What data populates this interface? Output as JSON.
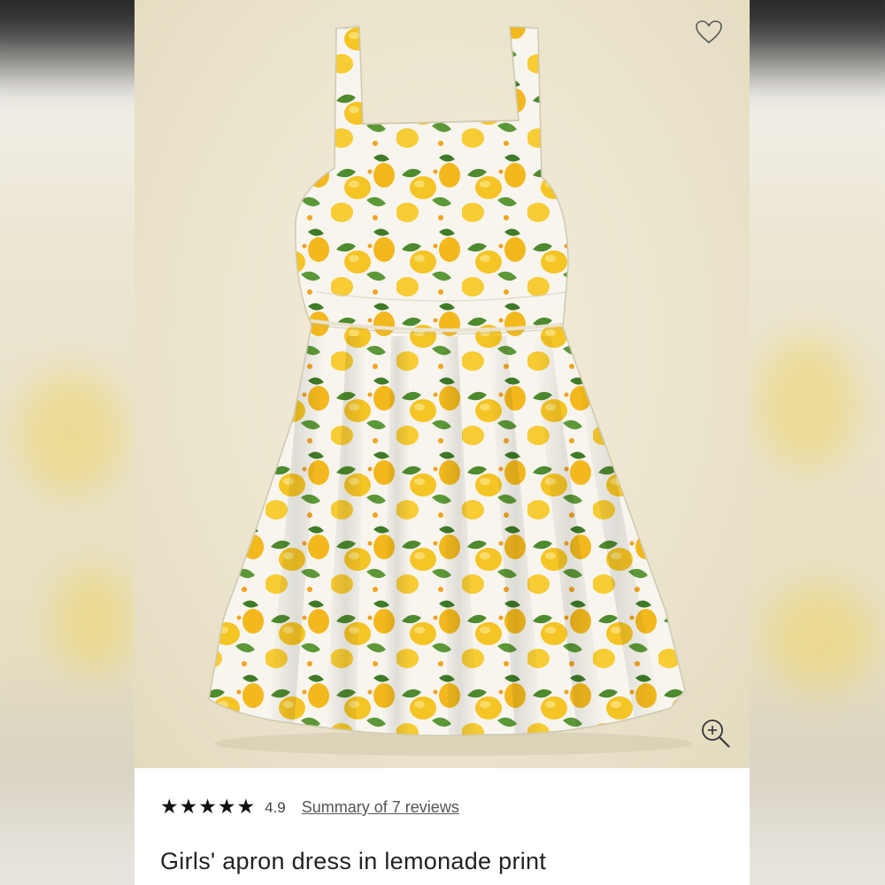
{
  "product": {
    "title": "Girls' apron dress in lemonade print",
    "rating_value": "4.9",
    "rating_stars": 5,
    "reviews_link": "Summary of 7 reviews"
  },
  "icons": {
    "favorite": "heart-icon",
    "zoom": "zoom-in-icon",
    "star": "star-icon"
  },
  "colors": {
    "lemon": "#f5c425",
    "leaf": "#4e8a2e",
    "fabric": "#f7f5ee",
    "backdrop": "#ece6d2"
  }
}
